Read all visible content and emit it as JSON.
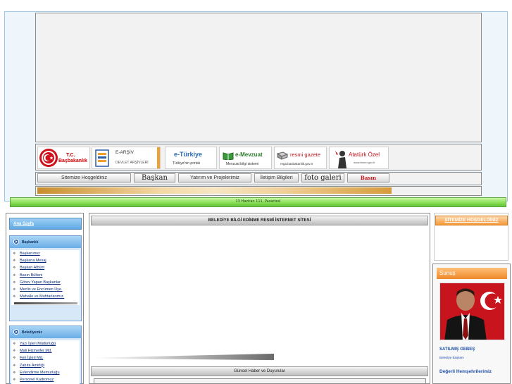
{
  "colors": {
    "header_frame_bg": "#eef6fb",
    "green_bar": "#8ee25a",
    "blue_tab": "#5fa8e3",
    "orange_tab": "#f29a3a",
    "link": "#0a2a7a",
    "mayor_text": "#1e4fa8"
  },
  "logos": [
    {
      "name": "basbakanlik",
      "line1": "T.C.",
      "line2": "Başbakanlık",
      "icon": "crescent-star-seal-icon"
    },
    {
      "name": "e-arsiv",
      "line1": "E-ARŞİV",
      "line2": "DEVLET ARŞİVLERİ",
      "icon": "archive-book-icon"
    },
    {
      "name": "e-turkiye",
      "line1": "e-Türkiye",
      "line2": "Türkiye'nin portalı"
    },
    {
      "name": "e-mevzuat",
      "line1": "e-Mevzuat",
      "line2": "Mevzuat bilgi sistemi",
      "icon": "green-book-icon"
    },
    {
      "name": "resmi-gazete",
      "line1": "resmi gazete",
      "line2": "rega.basbakanlik.gov.tr",
      "icon": "newspaper-icon"
    },
    {
      "name": "ataturk-ozel",
      "line1": "Atatürk Özel",
      "line2": "www.tbmm.gov.tr",
      "icon": "ataturk-silhouette-icon"
    }
  ],
  "nav": {
    "welcome": "Sitemize Hoşgeldiniz",
    "president": "Başkan",
    "projects": "Yatırım ve Projelerimiz",
    "contact": "İletişim Bilgileri",
    "gallery": "foto galeri",
    "press": "Basın"
  },
  "date_bar": "13 Haziran 111, Pazartesi",
  "left": {
    "home": "Ana Sayfa",
    "baskanlik": {
      "title": "Başkanlık",
      "items": [
        "Başkanımız",
        "Başkana Mesaj",
        "Başkan Albüm",
        "Basın Bülteni",
        "Görev Yapan Başkanlar",
        "Meclis ve Encümen Üye.",
        "Mahalle ve Muhtarlarımız."
      ]
    },
    "belediyemiz": {
      "title": "Belediyemiz",
      "items": [
        "Yazı İşleri Müdürlüğü",
        "Mali Hizmetler Md.",
        "Fen İşleri Md.",
        "Zabıta Amirliği",
        "Evlendirme Memurluğu",
        "Personel Kadromuz"
      ]
    }
  },
  "center": {
    "title": "BELEDİYE BİLGİ EDİNME RESMİ İNTERNET SİTESİ",
    "news_title": "Güncel Haber ve Duyurular"
  },
  "right": {
    "welcome_tab": "SİTEMİZE HOŞGELDİNİZ",
    "sunus": "Sunuş",
    "mayor_name": "SATILMIŞ GEBEŞ",
    "mayor_title": "Belediye Başkanı",
    "citizens": "Değerli Hemşehrilerimiz"
  }
}
